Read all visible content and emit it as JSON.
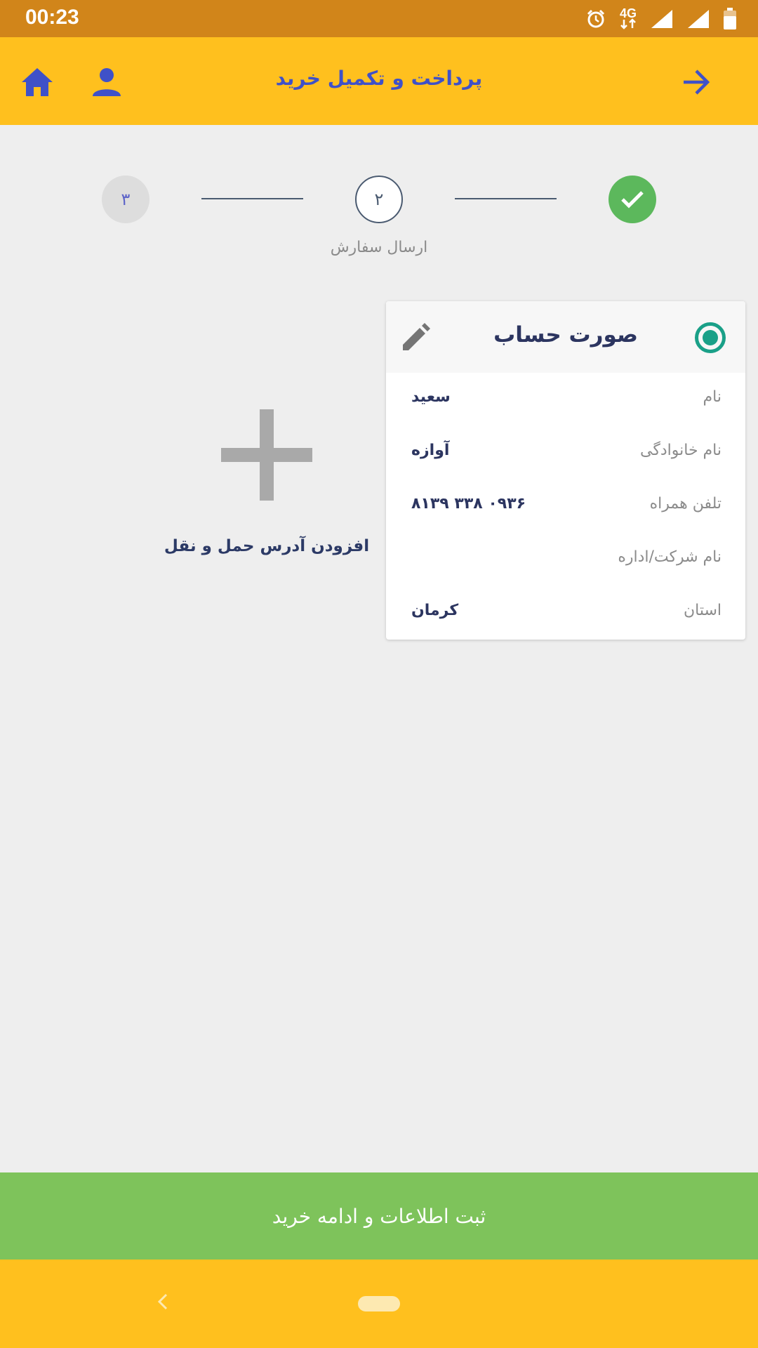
{
  "status_bar": {
    "time": "00:23",
    "network": "4G"
  },
  "app_bar": {
    "title": "پرداخت و تکمیل خرید"
  },
  "colors": {
    "app_bar": "#ffc01e",
    "status_bar": "#d1851a",
    "accent": "#3f51c8",
    "success": "#5cb85c",
    "submit": "#7ec35b",
    "radio": "#1aa088"
  },
  "stepper": {
    "steps": [
      {
        "state": "completed",
        "label": ""
      },
      {
        "number": "۲",
        "state": "current",
        "label": "ارسال سفارش"
      },
      {
        "number": "۳",
        "state": "upcoming",
        "label": ""
      }
    ]
  },
  "add_address": {
    "label": "افزودن آدرس حمل و نقل"
  },
  "invoice_card": {
    "title": "صورت حساب",
    "selected": true,
    "rows": [
      {
        "label": "نام",
        "value": "سعید"
      },
      {
        "label": "نام خانوادگی",
        "value": "آوازه"
      },
      {
        "label": "تلفن همراه",
        "value": "۰۹۳۶ ۳۳۸ ۸۱۳۹"
      },
      {
        "label": "نام شرکت/اداره",
        "value": ""
      },
      {
        "label": "استان",
        "value": "کرمان"
      }
    ]
  },
  "submit": {
    "label": "ثبت اطلاعات و ادامه خرید"
  },
  "icons": {
    "back": "arrow-right-icon",
    "profile": "person-icon",
    "home": "home-icon",
    "edit": "pencil-icon",
    "add": "plus-icon",
    "done": "check-icon"
  }
}
